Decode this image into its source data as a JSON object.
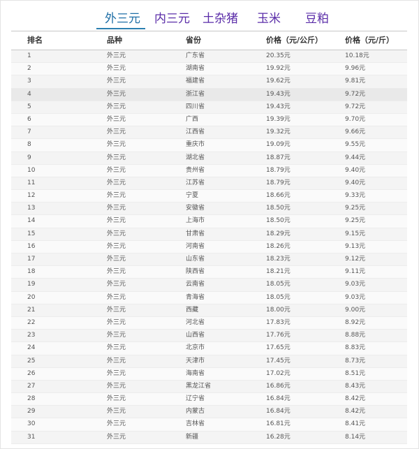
{
  "tabs": [
    "外三元",
    "内三元",
    "土杂猪",
    "玉米",
    "豆粕"
  ],
  "active_tab": 0,
  "table": {
    "headers": [
      "排名",
      "品种",
      "省份",
      "价格（元/公斤）",
      "价格（元/斤）"
    ],
    "rows": [
      [
        "1",
        "外三元",
        "广东省",
        "20.35元",
        "10.18元"
      ],
      [
        "2",
        "外三元",
        "湖南省",
        "19.92元",
        "9.96元"
      ],
      [
        "3",
        "外三元",
        "福建省",
        "19.62元",
        "9.81元"
      ],
      [
        "4",
        "外三元",
        "浙江省",
        "19.43元",
        "9.72元"
      ],
      [
        "5",
        "外三元",
        "四川省",
        "19.43元",
        "9.72元"
      ],
      [
        "6",
        "外三元",
        "广西",
        "19.39元",
        "9.70元"
      ],
      [
        "7",
        "外三元",
        "江西省",
        "19.32元",
        "9.66元"
      ],
      [
        "8",
        "外三元",
        "重庆市",
        "19.09元",
        "9.55元"
      ],
      [
        "9",
        "外三元",
        "湖北省",
        "18.87元",
        "9.44元"
      ],
      [
        "10",
        "外三元",
        "贵州省",
        "18.79元",
        "9.40元"
      ],
      [
        "11",
        "外三元",
        "江苏省",
        "18.79元",
        "9.40元"
      ],
      [
        "12",
        "外三元",
        "宁夏",
        "18.66元",
        "9.33元"
      ],
      [
        "13",
        "外三元",
        "安徽省",
        "18.50元",
        "9.25元"
      ],
      [
        "14",
        "外三元",
        "上海市",
        "18.50元",
        "9.25元"
      ],
      [
        "15",
        "外三元",
        "甘肃省",
        "18.29元",
        "9.15元"
      ],
      [
        "16",
        "外三元",
        "河南省",
        "18.26元",
        "9.13元"
      ],
      [
        "17",
        "外三元",
        "山东省",
        "18.23元",
        "9.12元"
      ],
      [
        "18",
        "外三元",
        "陕西省",
        "18.21元",
        "9.11元"
      ],
      [
        "19",
        "外三元",
        "云南省",
        "18.05元",
        "9.03元"
      ],
      [
        "20",
        "外三元",
        "青海省",
        "18.05元",
        "9.03元"
      ],
      [
        "21",
        "外三元",
        "西藏",
        "18.00元",
        "9.00元"
      ],
      [
        "22",
        "外三元",
        "河北省",
        "17.83元",
        "8.92元"
      ],
      [
        "23",
        "外三元",
        "山西省",
        "17.76元",
        "8.88元"
      ],
      [
        "24",
        "外三元",
        "北京市",
        "17.65元",
        "8.83元"
      ],
      [
        "25",
        "外三元",
        "天津市",
        "17.45元",
        "8.73元"
      ],
      [
        "26",
        "外三元",
        "海南省",
        "17.02元",
        "8.51元"
      ],
      [
        "27",
        "外三元",
        "黑龙江省",
        "16.86元",
        "8.43元"
      ],
      [
        "28",
        "外三元",
        "辽宁省",
        "16.84元",
        "8.42元"
      ],
      [
        "29",
        "外三元",
        "内蒙古",
        "16.84元",
        "8.42元"
      ],
      [
        "30",
        "外三元",
        "吉林省",
        "16.81元",
        "8.41元"
      ],
      [
        "31",
        "外三元",
        "新疆",
        "16.28元",
        "8.14元"
      ]
    ]
  }
}
